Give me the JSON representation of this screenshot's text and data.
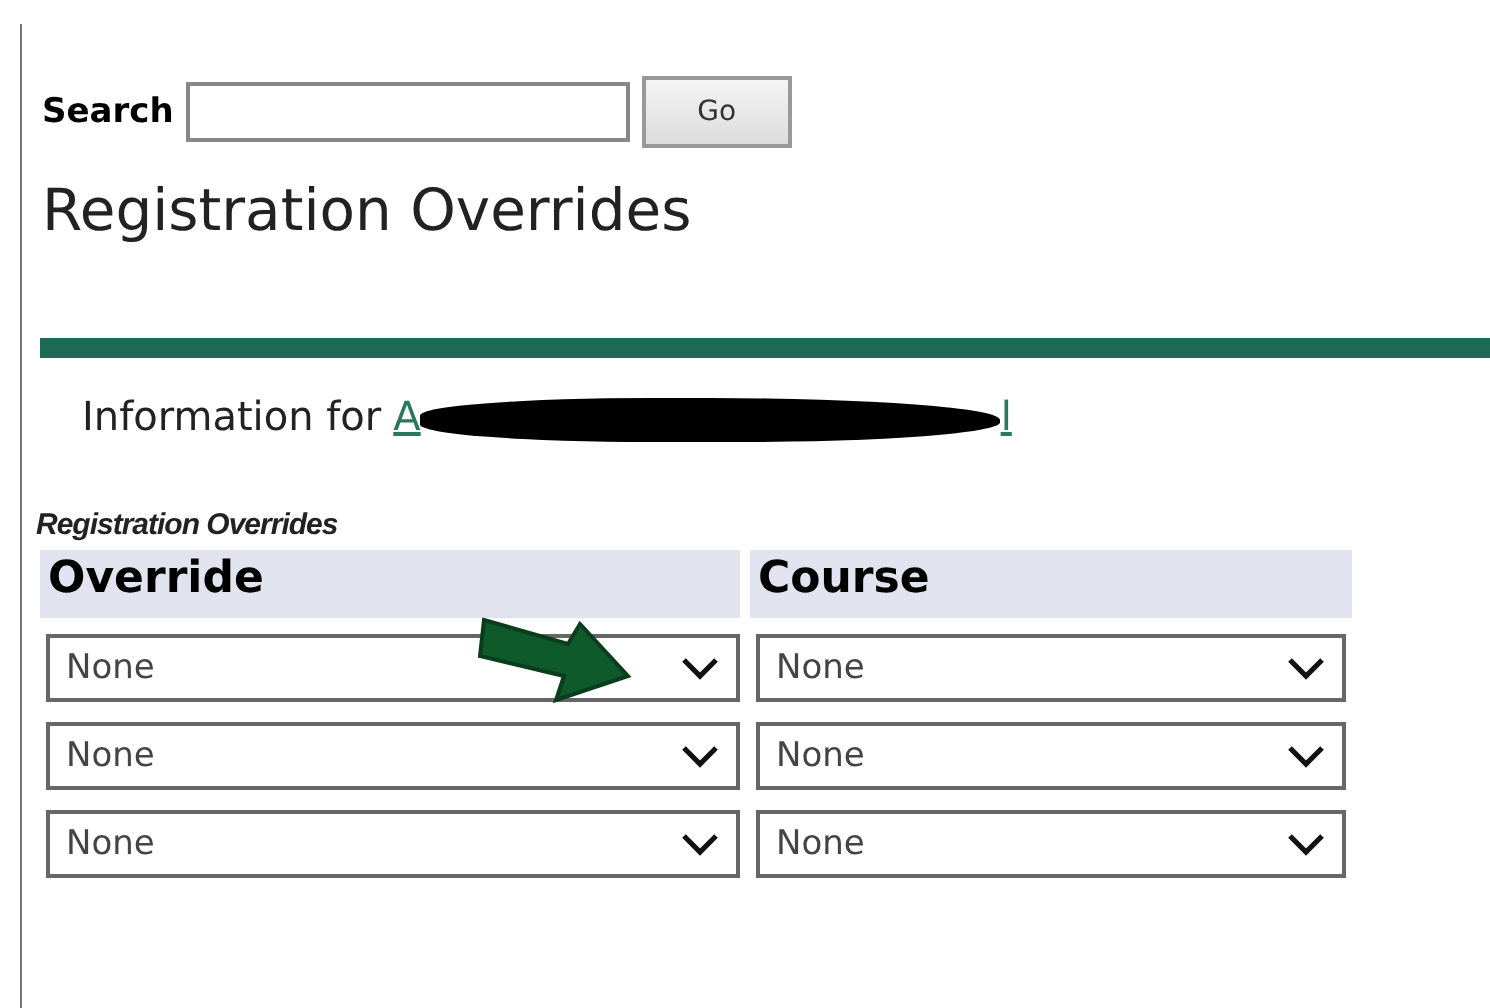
{
  "search": {
    "label": "Search",
    "button": "Go"
  },
  "title": "Registration Overrides",
  "info": {
    "label": "Information for",
    "link_start": "A",
    "link_end": "l"
  },
  "table": {
    "caption": "Registration Overrides",
    "columns": [
      "Override",
      "Course"
    ],
    "rows": [
      {
        "override": "None",
        "course": "None"
      },
      {
        "override": "None",
        "course": "None"
      },
      {
        "override": "None",
        "course": "None"
      }
    ]
  }
}
